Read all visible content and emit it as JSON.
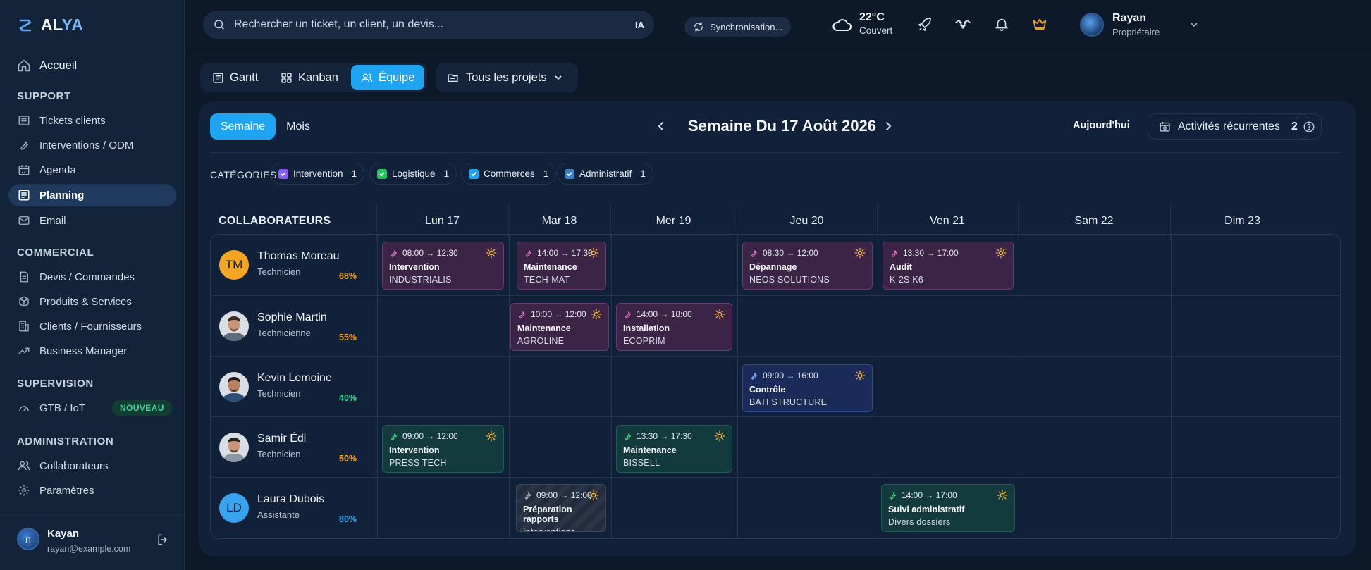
{
  "app": {
    "logo_main": "AL",
    "logo_accent": "YA"
  },
  "sidebar": {
    "home": "Accueil",
    "sections": {
      "support": "SUPPORT",
      "commercial": "COMMERCIAL",
      "supervision": "SUPERVISION",
      "administration": "ADMINISTRATION"
    },
    "items": {
      "tickets": "Tickets clients",
      "interventions": "Interventions / ODM",
      "agenda": "Agenda",
      "planning": "Planning",
      "email": "Email",
      "devis": "Devis / Commandes",
      "produits": "Produits & Services",
      "clients": "Clients / Fournisseurs",
      "business": "Business Manager",
      "gtb": "GTB / IoT",
      "gtb_badge": "NOUVEAU",
      "collaborateurs": "Collaborateurs",
      "parametres": "Paramètres"
    },
    "user": {
      "initial": "n",
      "name": "Kayan",
      "email": "rayan@example.com"
    }
  },
  "topbar": {
    "search_placeholder": "Rechercher un ticket, un client, un devis...",
    "search_ia": "IA",
    "sync": "Synchronisation...",
    "weather_temp": "22°C",
    "weather_desc": "Couvert",
    "user_name": "Rayan",
    "user_role": "Propriétaire"
  },
  "views": {
    "gantt": "Gantt",
    "kanban": "Kanban",
    "equipe": "Équipe",
    "projects": "Tous les projets"
  },
  "toolbar": {
    "week": "Semaine",
    "month": "Mois",
    "title": "Semaine Du 17 Août 2026",
    "today": "Aujourd'hui",
    "recurring": "Activités récurrentes",
    "recurring_count": "2"
  },
  "categories": {
    "label": "CATÉGORIES",
    "items": [
      {
        "name": "Intervention",
        "count": "1",
        "color": "#8b5cf6"
      },
      {
        "name": "Logistique",
        "count": "1",
        "color": "#22c55e"
      },
      {
        "name": "Commerces",
        "count": "1",
        "color": "#1ea4f0"
      },
      {
        "name": "Administratif",
        "count": "1",
        "color": "#3b82c4"
      }
    ]
  },
  "grid": {
    "header": "COLLABORATEURS",
    "days": [
      "Lun 17",
      "Mar 18",
      "Mer 19",
      "Jeu 20",
      "Ven 21",
      "Sam 22",
      "Dim 23"
    ],
    "people": [
      {
        "name": "Thomas Moreau",
        "role": "Technicien",
        "load": "68%",
        "initials": "TM"
      },
      {
        "name": "Sophie Martin",
        "role": "Technicienne",
        "load": "55%",
        "initials": ""
      },
      {
        "name": "Kevin Lemoine",
        "role": "Technicien",
        "load": "40%",
        "initials": ""
      },
      {
        "name": "Samir Édi",
        "role": "Technicien",
        "load": "50%",
        "initials": ""
      },
      {
        "name": "Laura Dubois",
        "role": "Assistante",
        "load": "80%",
        "initials": "LD"
      }
    ],
    "events": [
      {
        "time": "08:00 → 12:30",
        "title": "Intervention",
        "client": "INDUSTRIALIS"
      },
      {
        "time": "14:00 → 17:30",
        "title": "Maintenance",
        "client": "TECH-MAT"
      },
      {
        "time": "08:30 → 12:00",
        "title": "Dépannage",
        "client": "NEOS SOLUTIONS"
      },
      {
        "time": "13:30 → 17:00",
        "title": "Audit",
        "client": "K-2S K6"
      },
      {
        "time": "10:00 → 12:00",
        "title": "Maintenance",
        "client": "AGROLINE"
      },
      {
        "time": "14:00 → 18:00",
        "title": "Installation",
        "client": "ECOPRIM"
      },
      {
        "time": "09:00 → 16:00",
        "title": "Contrôle",
        "client": "BATI STRUCTURE"
      },
      {
        "time": "09:00 → 12:00",
        "title": "Intervention",
        "client": "PRESS TECH"
      },
      {
        "time": "13:30 → 17:30",
        "title": "Maintenance",
        "client": "BISSELL"
      },
      {
        "time": "09:00 → 12:00",
        "title": "Préparation rapports",
        "client": "Interventions"
      },
      {
        "time": "14:00 → 17:00",
        "title": "Suivi administratif",
        "client": "Divers dossiers"
      }
    ]
  },
  "colors": {
    "accent": "#1ea4f0",
    "load_orange": "#f5a524",
    "load_green": "#3fd49b",
    "load_blue": "#4aa8f0"
  }
}
